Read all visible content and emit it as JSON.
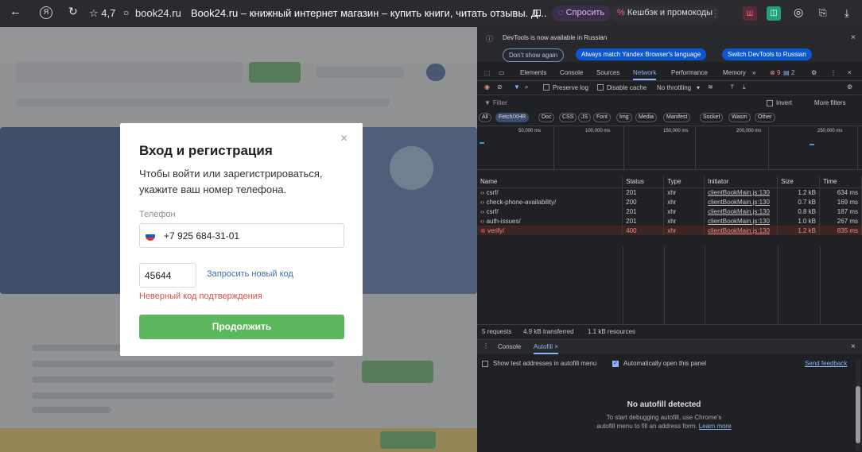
{
  "browser": {
    "rating": "☆ 4,7",
    "domain": "book24.ru",
    "tab_title": "Book24.ru – книжный интернет магазин – купить книги, читать отзывы. Д...",
    "ask_label": "Спросить",
    "cashback_label": "Кешбэк и промокоды"
  },
  "modal": {
    "title": "Вход и регистрация",
    "description": "Чтобы войти или зарегистрироваться, укажите ваш номер телефона.",
    "phone_label": "Телефон",
    "phone_value": "+7 925 684-31-01",
    "code_value": "45644",
    "resend_link": "Запросить новый код",
    "error": "Неверный код подтверждения",
    "submit": "Продолжить"
  },
  "devtools": {
    "banner": {
      "text": "DevTools is now available in Russian",
      "btn_dont_show": "Don't show again",
      "btn_match": "Always match Yandex Browser's language",
      "btn_switch": "Switch DevTools to Russian"
    },
    "tabs": [
      "Elements",
      "Console",
      "Sources",
      "Network",
      "Performance",
      "Memory"
    ],
    "badges": {
      "errors": "9",
      "messages": "2"
    },
    "toolbar": {
      "preserve_log": "Preserve log",
      "disable_cache": "Disable cache",
      "throttling": "No throttling"
    },
    "filter": {
      "placeholder": "Filter",
      "invert": "Invert",
      "more_filters": "More filters"
    },
    "type_filters": [
      "All",
      "Fetch/XHR",
      "Doc",
      "CSS",
      "JS",
      "Font",
      "Img",
      "Media",
      "Manifest",
      "Socket",
      "Wasm",
      "Other"
    ],
    "timeline_ticks": [
      "50,000 ms",
      "100,000 ms",
      "150,000 ms",
      "200,000 ms",
      "250,000 ms"
    ],
    "columns": [
      "Name",
      "Status",
      "Type",
      "Initiator",
      "Size",
      "Time"
    ],
    "requests": [
      {
        "name": "csrf/",
        "status": "201",
        "type": "xhr",
        "initiator": "clientBookMain.js:130",
        "size": "1.2 kB",
        "time": "634 ms",
        "error": false
      },
      {
        "name": "check-phone-availability/",
        "status": "200",
        "type": "xhr",
        "initiator": "clientBookMain.js:130",
        "size": "0.7 kB",
        "time": "169 ms",
        "error": false
      },
      {
        "name": "csrf/",
        "status": "201",
        "type": "xhr",
        "initiator": "clientBookMain.js:130",
        "size": "0.8 kB",
        "time": "187 ms",
        "error": false
      },
      {
        "name": "auth-issues/",
        "status": "201",
        "type": "xhr",
        "initiator": "clientBookMain.js:130",
        "size": "1.0 kB",
        "time": "267 ms",
        "error": false
      },
      {
        "name": "verify/",
        "status": "400",
        "type": "xhr",
        "initiator": "clientBookMain.js:130",
        "size": "1.2 kB",
        "time": "835 ms",
        "error": true
      }
    ],
    "summary": {
      "requests": "5 requests",
      "transferred": "4.9 kB transferred",
      "resources": "1.1 kB resources"
    },
    "drawer": {
      "tab_console": "Console",
      "tab_autofill": "Autofill",
      "show_test": "Show test addresses in autofill menu",
      "auto_open": "Automatically open this panel",
      "send_feedback": "Send feedback",
      "empty_title": "No autofill detected",
      "empty_line1": "To start debugging autofill, use Chrome's",
      "empty_line2": "autofill menu to fill an address form.",
      "learn_more": "Learn more"
    }
  },
  "colors": {
    "accent_green": "#5cb85c",
    "error_red": "#e04b4b",
    "link_blue": "#3d6fb6",
    "devtools_bg": "#202124",
    "devtools_accent": "#8ab4f8",
    "banner_btn": "#0b57d0"
  }
}
